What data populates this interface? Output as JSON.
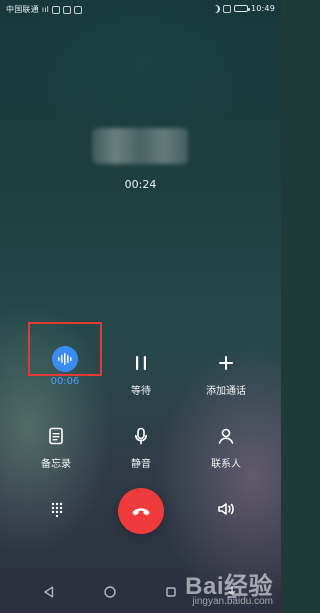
{
  "status_bar": {
    "carrier": "中国联通",
    "signal": "ııl",
    "time": "10:49"
  },
  "call": {
    "timer": "00:24"
  },
  "controls": {
    "record_time": "00:06",
    "hold_label": "等待",
    "add_call_label": "添加通话",
    "notes_label": "备忘录",
    "mute_label": "静音",
    "contacts_label": "联系人"
  },
  "watermark": {
    "brand": "Bai",
    "brand_suffix": "经验",
    "domain": "jingyan.baidu.com"
  },
  "colors": {
    "record_blue": "#3b8cf2",
    "highlight_red": "#e53935",
    "end_call_red": "#ef3b3b"
  },
  "icons": {
    "record": "record-waveform-icon",
    "hold": "pause-icon",
    "add_call": "plus-icon",
    "notes": "notes-icon",
    "mute": "microphone-icon",
    "contacts": "person-icon",
    "dialpad": "dialpad-icon",
    "end_call": "phone-hangup-icon",
    "speaker": "speaker-icon"
  }
}
